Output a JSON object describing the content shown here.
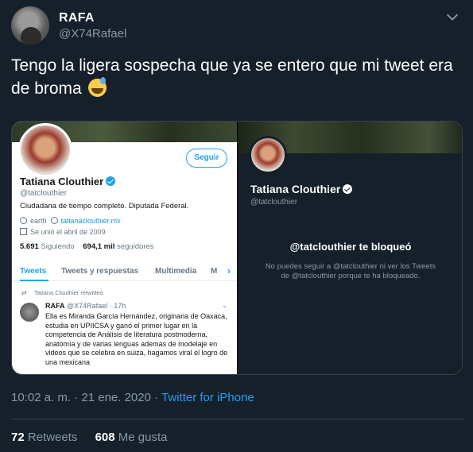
{
  "author": {
    "name": "RAFA",
    "handle": "@X74Rafael"
  },
  "tweet": {
    "text": "Tengo la ligera sospecha que ya se entero que mi tweet era de broma",
    "emoji": "sweat-smile-emoji"
  },
  "left_screenshot": {
    "follow_label": "Seguir",
    "name": "Tatiana Clouthier",
    "handle": "@tatclouthier",
    "bio": "Ciudadana de tiempo completo. Diputada Federal.",
    "location": "earth",
    "website": "tatianaclouthier.mx",
    "joined": "Se unió el abril de 2009",
    "following_count": "5.691",
    "following_label": "Siguiendo",
    "followers_count": "694,1 mil",
    "followers_label": "seguidores",
    "tabs": [
      "Tweets",
      "Tweets y respuestas",
      "Multimedia",
      "M"
    ],
    "retweet_label": "Tatiana Clouthier retwitteó",
    "inner_tweet": {
      "name": "RAFA",
      "handle": "@X74Rafael",
      "time": "· 17h",
      "text": "Ella es Miranda García Hernández, originaria de Oaxaca, estudia en UPIICSA y ganó el primer lugar en la competencia de Análisis de literatura postmoderna, anatomía y de varias lenguas ademas de modelaje en videos que se celebra en suiza, hagamos viral el logro de una mexicana"
    }
  },
  "right_screenshot": {
    "name": "Tatiana Clouthier",
    "handle": "@tatclouthier",
    "blocked_title": "@tatclouthier te bloqueó",
    "blocked_text": "No puedes seguir a @tatclouthier ni ver los Tweets de @tatclouthier porque te ha bloqueado."
  },
  "meta": {
    "time": "10:02 a. m. · 21 ene. 2020 · ",
    "source": "Twitter for iPhone"
  },
  "stats": {
    "retweets_count": "72",
    "retweets_label": "Retweets",
    "likes_count": "608",
    "likes_label": "Me gusta"
  },
  "colors": {
    "background": "#15202b",
    "accent": "#1da1f2",
    "muted": "#8899a6",
    "divider": "#38444d"
  }
}
